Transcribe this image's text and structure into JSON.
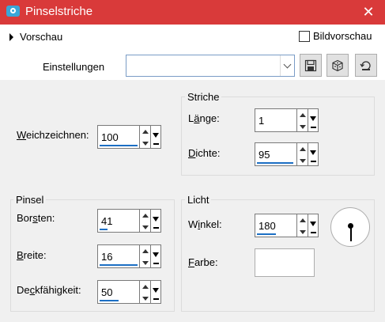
{
  "window": {
    "title": "Pinselstriche",
    "close": "✕"
  },
  "preview": {
    "toggle_label": "Vorschau",
    "bild_label": "Bildvorschau"
  },
  "presets": {
    "label": "Einstellungen",
    "value": ""
  },
  "weich": {
    "label_prefix": "",
    "label_u": "W",
    "label_rest": "eichzeichnen:",
    "value": "100",
    "bar_fraction": 1.0
  },
  "striche": {
    "title": "Striche",
    "laenge": {
      "label_pre": "L",
      "label_u": "ä",
      "label_rest": "nge:",
      "value": "1",
      "bar_fraction": 0.0
    },
    "dichte": {
      "label_pre": "",
      "label_u": "D",
      "label_rest": "ichte:",
      "value": "95",
      "bar_fraction": 0.95
    }
  },
  "pinsel": {
    "title": "Pinsel",
    "borsten": {
      "label_pre": "Bor",
      "label_u": "s",
      "label_rest": "ten:",
      "value": "41",
      "bar_fraction": 0.2
    },
    "breite": {
      "label_pre": "",
      "label_u": "B",
      "label_rest": "reite:",
      "value": "16",
      "bar_fraction": 1.0
    },
    "deck": {
      "label_pre": "De",
      "label_u": "c",
      "label_rest": "kfähigkeit:",
      "value": "50",
      "bar_fraction": 0.5
    }
  },
  "licht": {
    "title": "Licht",
    "winkel": {
      "label_pre": "W",
      "label_u": "i",
      "label_rest": "nkel:",
      "value": "180",
      "bar_fraction": 0.5
    },
    "farbe": {
      "label_pre": "",
      "label_u": "F",
      "label_rest": "arbe:",
      "color": "#ffffff"
    }
  },
  "colors": {
    "titlebar": "#d93a3a",
    "accent": "#1c6fc4"
  }
}
